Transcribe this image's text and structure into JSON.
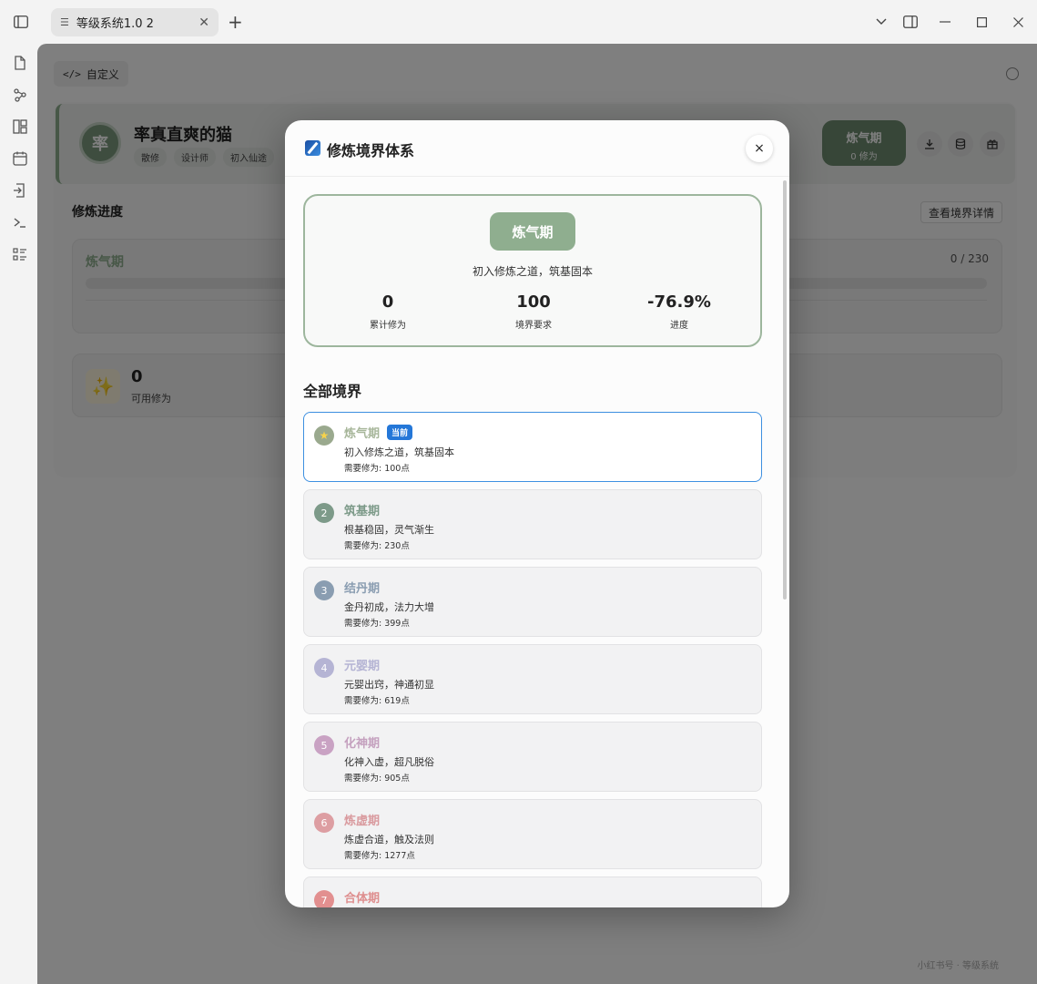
{
  "window": {
    "tab_title": "等级系统1.0 2",
    "new_tab": "+"
  },
  "toolbar": {
    "custom_label": "自定义",
    "code_glyph": "</>"
  },
  "profile": {
    "avatar_char": "率",
    "name": "率真直爽的猫",
    "tags": [
      "散修",
      "设计师",
      "初入仙途"
    ],
    "level_name": "炼气期",
    "level_sub": "0 修为"
  },
  "progress": {
    "title": "修炼进度",
    "detail_button": "查看境界详情",
    "realm_name": "炼气期",
    "count": "0 / 230",
    "available_value": "0",
    "available_label": "可用修为"
  },
  "footer": "小红书号 · 等级系统",
  "modal": {
    "title": "修炼境界体系",
    "close": "×",
    "current": {
      "name": "炼气期",
      "desc": "初入修炼之道，筑基固本",
      "stats": [
        {
          "value": "0",
          "label": "累计修为"
        },
        {
          "value": "100",
          "label": "境界要求"
        },
        {
          "value": "-76.9%",
          "label": "进度"
        }
      ]
    },
    "all_title": "全部境界",
    "current_badge": "当前",
    "realms": [
      {
        "num": "★",
        "name": "炼气期",
        "desc": "初入修炼之道，筑基固本",
        "req": "需要修为: 100点",
        "color": "#a7b69a",
        "num_bg": "#9aa98e"
      },
      {
        "num": "2",
        "name": "筑基期",
        "desc": "根基稳固，灵气渐生",
        "req": "需要修为: 230点",
        "color": "#7d9a89",
        "num_bg": "#7d9a89"
      },
      {
        "num": "3",
        "name": "结丹期",
        "desc": "金丹初成，法力大增",
        "req": "需要修为: 399点",
        "color": "#8a9db1",
        "num_bg": "#8a9db1"
      },
      {
        "num": "4",
        "name": "元婴期",
        "desc": "元婴出窍，神通初显",
        "req": "需要修为: 619点",
        "color": "#b5b4d4",
        "num_bg": "#b5b4d4"
      },
      {
        "num": "5",
        "name": "化神期",
        "desc": "化神入虚，超凡脱俗",
        "req": "需要修为: 905点",
        "color": "#c4a0be",
        "num_bg": "#c9a2c3"
      },
      {
        "num": "6",
        "name": "炼虚期",
        "desc": "炼虚合道，触及法则",
        "req": "需要修为: 1277点",
        "color": "#d99a9e",
        "num_bg": "#dd9ea2"
      },
      {
        "num": "7",
        "name": "合体期",
        "desc": "",
        "req": "",
        "color": "#de8e8e",
        "num_bg": "#e28f8f"
      }
    ]
  }
}
